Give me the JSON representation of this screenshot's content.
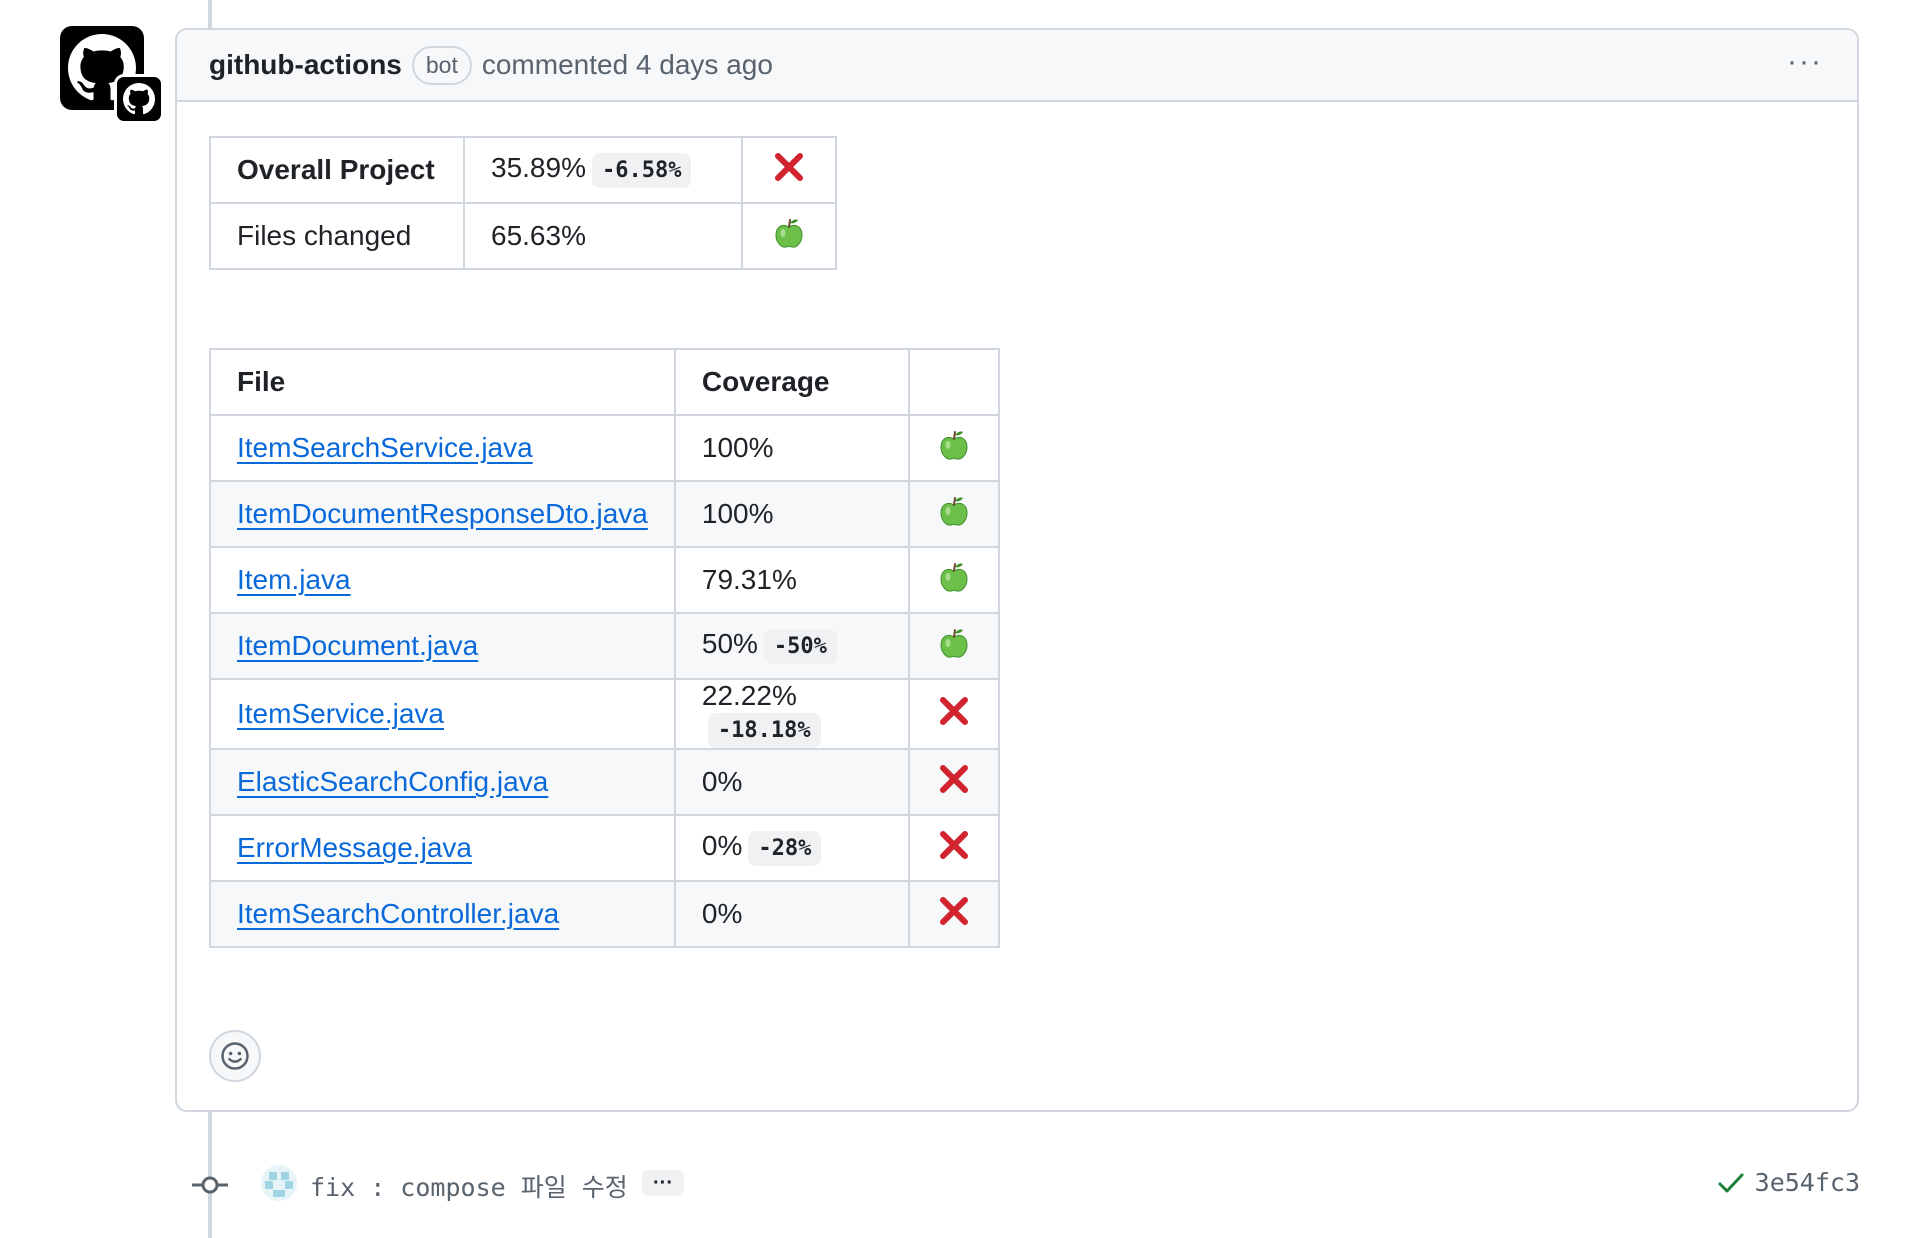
{
  "comment": {
    "author": "github-actions",
    "badge": "bot",
    "timestamp": "commented 4 days ago",
    "more_label": "···"
  },
  "summary_rows": [
    {
      "label": "Overall Project",
      "value": "35.89%",
      "delta": "-6.58%",
      "status_icon": "cross-mark-icon"
    },
    {
      "label": "Files changed",
      "value": "65.63%",
      "delta": "",
      "status_icon": "green-apple-icon"
    }
  ],
  "files_table": {
    "headers": [
      "File",
      "Coverage",
      ""
    ],
    "rows": [
      {
        "file": "ItemSearchService.java",
        "coverage": "100%",
        "delta": "",
        "status_icon": "green-apple-icon"
      },
      {
        "file": "ItemDocumentResponseDto.java",
        "coverage": "100%",
        "delta": "",
        "status_icon": "green-apple-icon"
      },
      {
        "file": "Item.java",
        "coverage": "79.31%",
        "delta": "",
        "status_icon": "green-apple-icon"
      },
      {
        "file": "ItemDocument.java",
        "coverage": "50%",
        "delta": "-50%",
        "status_icon": "green-apple-icon"
      },
      {
        "file": "ItemService.java",
        "coverage": "22.22%",
        "delta": "-18.18%",
        "status_icon": "cross-mark-icon"
      },
      {
        "file": "ElasticSearchConfig.java",
        "coverage": "0%",
        "delta": "",
        "status_icon": "cross-mark-icon"
      },
      {
        "file": "ErrorMessage.java",
        "coverage": "0%",
        "delta": "-28%",
        "status_icon": "cross-mark-icon"
      },
      {
        "file": "ItemSearchController.java",
        "coverage": "0%",
        "delta": "",
        "status_icon": "cross-mark-icon"
      }
    ]
  },
  "commit": {
    "message": "fix : compose 파일 수정",
    "expand_label": "···",
    "sha": "3e54fc3"
  },
  "colors": {
    "link": "#0969da",
    "cross": "#d1242f",
    "apple": "#6cc04a",
    "check": "#1a7f37",
    "border": "#d0d7de"
  }
}
